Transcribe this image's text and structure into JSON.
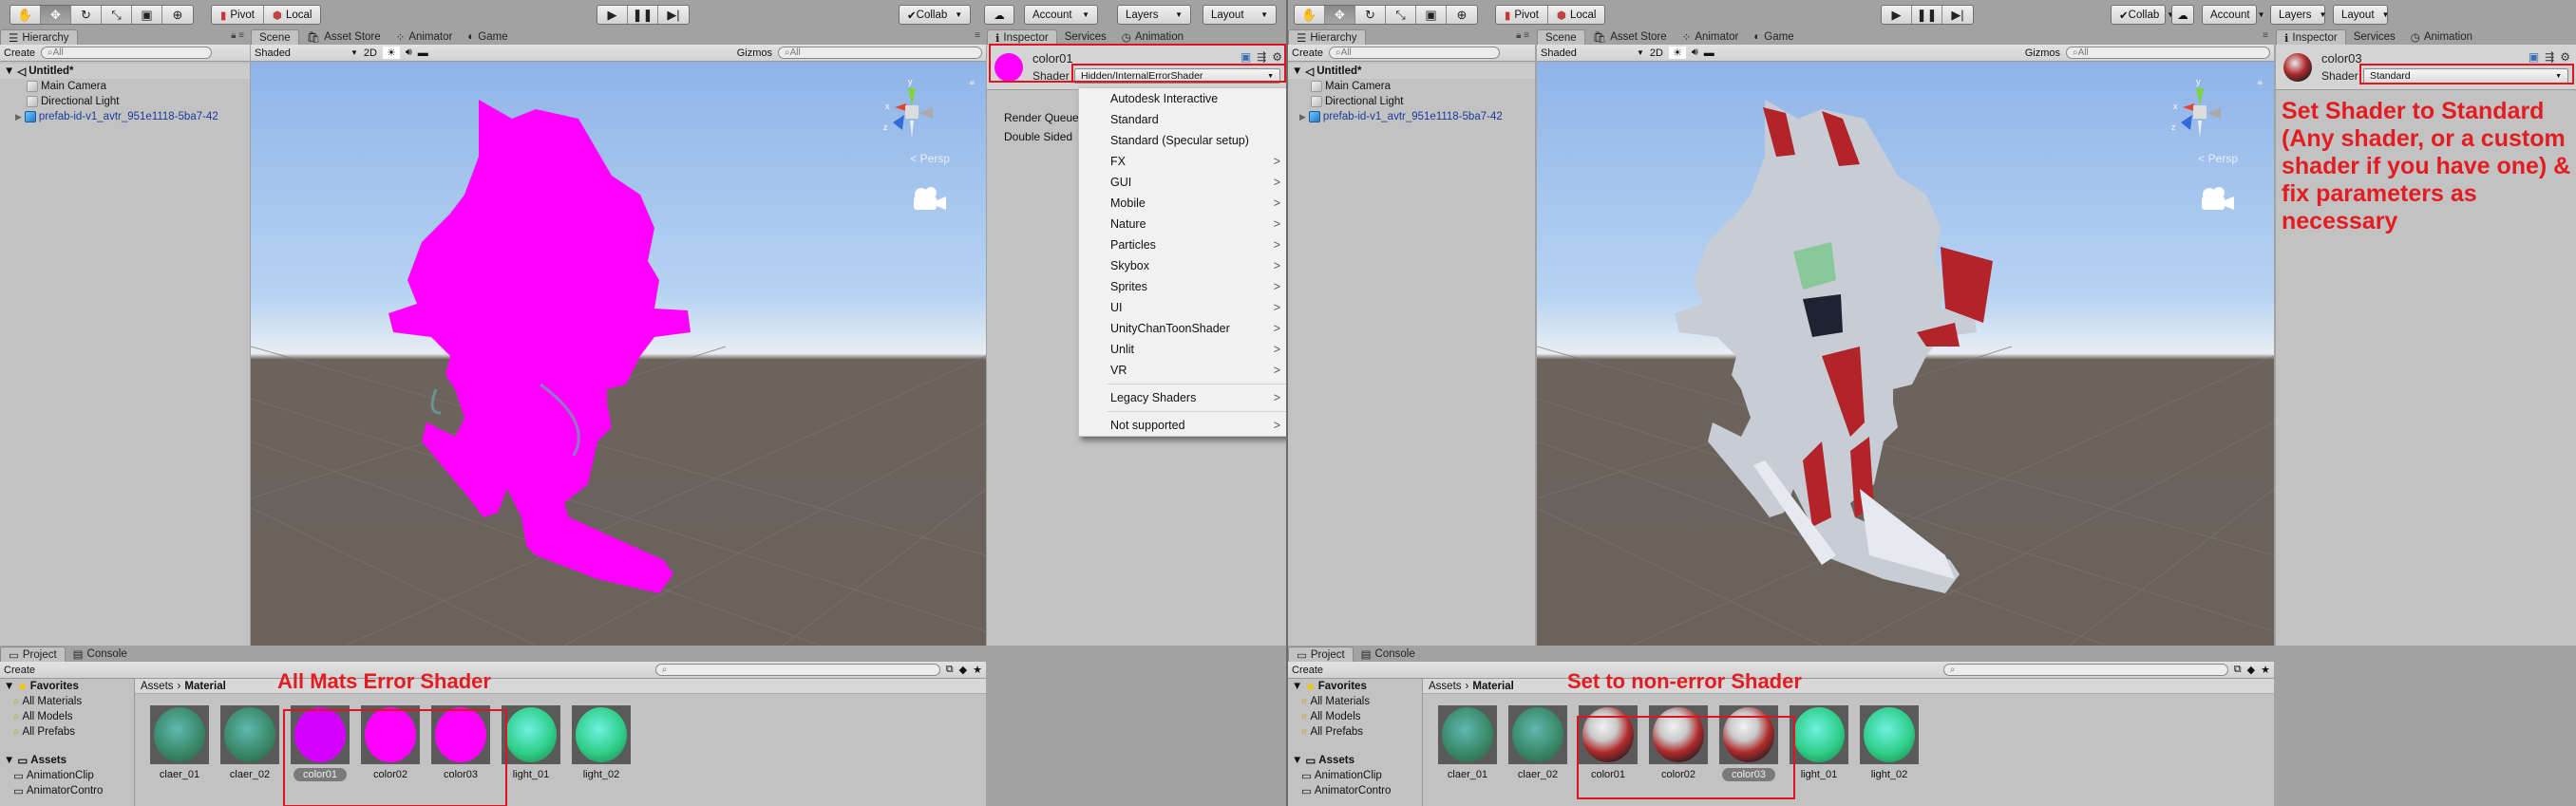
{
  "toolbar": {
    "transform_tools": [
      "hand-tool",
      "move-tool",
      "rotate-tool",
      "scale-tool",
      "rect-tool",
      "transform-tool"
    ],
    "pivot_label": "Pivot",
    "local_label": "Local",
    "play_controls": [
      "play",
      "pause",
      "step"
    ],
    "collab_label": "Collab",
    "account_label": "Account",
    "layers_label": "Layers",
    "layout_label": "Layout"
  },
  "hierarchy": {
    "tab_label": "Hierarchy",
    "create_label": "Create",
    "search_placeholder": "All",
    "scene_name": "Untitled*",
    "items": [
      "Main Camera",
      "Directional Light",
      "prefab-id-v1_avtr_951e1118-5ba7-42"
    ]
  },
  "scene": {
    "tabs": [
      "Scene",
      "Asset Store",
      "Animator",
      "Game"
    ],
    "shading_mode": "Shaded",
    "mode_2d": "2D",
    "gizmos_label": "Gizmos",
    "search_placeholder": "All",
    "persp_label": "Persp",
    "gizmo_axes": [
      "y",
      "x",
      "z"
    ]
  },
  "inspector": {
    "tabs": [
      "Inspector",
      "Services",
      "Animation"
    ],
    "left": {
      "material_name": "color01",
      "shader_label": "Shader",
      "shader_value": "Hidden/InternalErrorShader",
      "render_queue_label": "Render Queue",
      "double_sided_label": "Double Sided",
      "swatch_color": "#ff00ff"
    },
    "right": {
      "material_name": "color03",
      "shader_label": "Shader",
      "shader_value": "Standard"
    }
  },
  "shader_menu": {
    "items": [
      {
        "label": "Autodesk Interactive",
        "submenu": false
      },
      {
        "label": "Standard",
        "submenu": false
      },
      {
        "label": "Standard (Specular setup)",
        "submenu": false
      },
      {
        "label": "FX",
        "submenu": true
      },
      {
        "label": "GUI",
        "submenu": true
      },
      {
        "label": "Mobile",
        "submenu": true
      },
      {
        "label": "Nature",
        "submenu": true
      },
      {
        "label": "Particles",
        "submenu": true
      },
      {
        "label": "Skybox",
        "submenu": true
      },
      {
        "label": "Sprites",
        "submenu": true
      },
      {
        "label": "UI",
        "submenu": true
      },
      {
        "label": "UnityChanToonShader",
        "submenu": true
      },
      {
        "label": "Unlit",
        "submenu": true
      },
      {
        "label": "VR",
        "submenu": true
      },
      {
        "label": "Legacy Shaders",
        "submenu": true
      },
      {
        "label": "Not supported",
        "submenu": true
      }
    ],
    "submenu_arrow": ">"
  },
  "project": {
    "tabs": [
      "Project",
      "Console"
    ],
    "create_label": "Create",
    "favorites_label": "Favorites",
    "favorites": [
      "All Materials",
      "All Models",
      "All Prefabs"
    ],
    "assets_label": "Assets",
    "asset_folders": [
      "AnimationClip",
      "AnimatorContro"
    ],
    "breadcrumb": [
      "Assets",
      "Material"
    ],
    "materials": [
      "claer_01",
      "claer_02",
      "color01",
      "color02",
      "color03",
      "light_01",
      "light_02"
    ],
    "left_selected": "color01",
    "right_selected": "color03"
  },
  "annotations": {
    "left_bottom": "All Mats Error Shader",
    "right_bottom": "Set to non-error Shader",
    "right_inspector": "Set Shader to Standard (Any shader, or a custom shader if you have one) & fix parameters as necessary"
  },
  "colors": {
    "error_magenta": "#ff00ff",
    "annotation_red": "#e31c22"
  }
}
